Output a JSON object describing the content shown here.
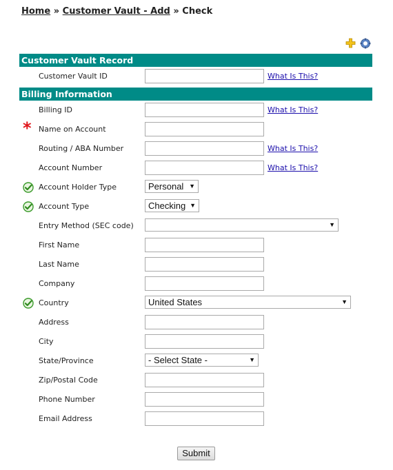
{
  "breadcrumb": {
    "home": "Home",
    "sep": "»",
    "vault_add": "Customer Vault - Add",
    "current": "Check"
  },
  "sections": {
    "vault": "Customer Vault Record",
    "billing": "Billing Information"
  },
  "help_link": "What Is This?",
  "fields": {
    "customer_vault_id": "Customer Vault ID",
    "billing_id": "Billing ID",
    "name_on_account": "Name on Account",
    "routing": "Routing / ABA Number",
    "account_number": "Account Number",
    "account_holder_type": "Account Holder Type",
    "account_type": "Account Type",
    "entry_method": "Entry Method (SEC code)",
    "first_name": "First Name",
    "last_name": "Last Name",
    "company": "Company",
    "country": "Country",
    "address": "Address",
    "city": "City",
    "state": "State/Province",
    "zip": "Zip/Postal Code",
    "phone": "Phone Number",
    "email": "Email Address"
  },
  "selects": {
    "account_holder_type": "Personal",
    "account_type": "Checking",
    "entry_method": "",
    "country": "United States",
    "state": "- Select State -"
  },
  "submit_label": "Submit",
  "colors": {
    "section_bg": "#008b87",
    "required": "#e0161b",
    "check": "#3a9a2a"
  }
}
